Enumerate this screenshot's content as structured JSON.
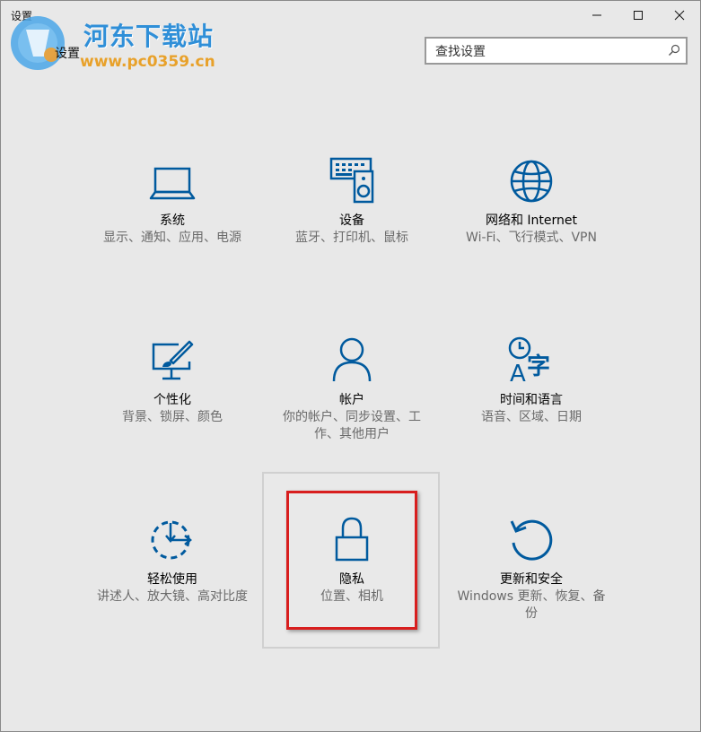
{
  "window": {
    "title": "设置",
    "heading": "设置",
    "controls": [
      "minimize-icon",
      "maximize-icon",
      "close-icon"
    ]
  },
  "watermark": {
    "name": "河东下载站",
    "url": "www.pc0359.cn"
  },
  "search": {
    "placeholder": "查找设置",
    "icon": "search-icon"
  },
  "accent_color": "#005a9e",
  "highlight_color": "#d81e1e",
  "tiles": [
    {
      "title": "系统",
      "desc": "显示、通知、应用、电源",
      "icon": "laptop-icon"
    },
    {
      "title": "设备",
      "desc": "蓝牙、打印机、鼠标",
      "icon": "keyboard-speaker-icon"
    },
    {
      "title": "网络和 Internet",
      "desc": "Wi-Fi、飞行模式、VPN",
      "icon": "globe-icon"
    },
    {
      "title": "个性化",
      "desc": "背景、锁屏、颜色",
      "icon": "paint-monitor-icon"
    },
    {
      "title": "帐户",
      "desc": "你的帐户、同步设置、工作、其他用户",
      "icon": "person-icon"
    },
    {
      "title": "时间和语言",
      "desc": "语音、区域、日期",
      "icon": "clock-language-icon"
    },
    {
      "title": "轻松使用",
      "desc": "讲述人、放大镜、高对比度",
      "icon": "ease-of-access-icon"
    },
    {
      "title": "隐私",
      "desc": "位置、相机",
      "icon": "lock-icon"
    },
    {
      "title": "更新和安全",
      "desc": "Windows 更新、恢复、备份",
      "icon": "refresh-icon"
    }
  ]
}
